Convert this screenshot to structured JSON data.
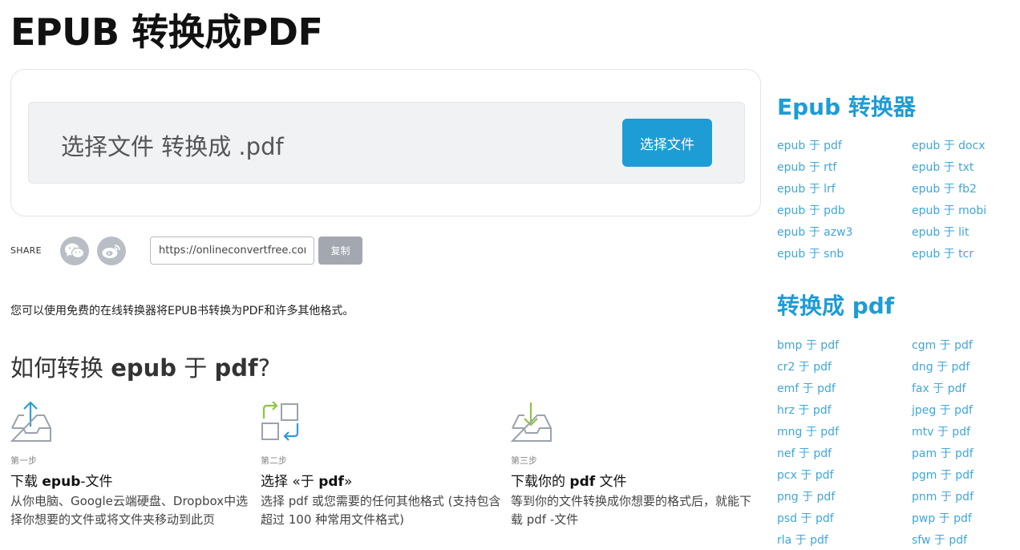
{
  "page_title": "EPUB 转换成PDF",
  "upload": {
    "prompt": "选择文件 转换成 .pdf",
    "choose_button": "选择文件"
  },
  "share": {
    "label": "SHARE",
    "url_value": "https://onlineconvertfree.com",
    "copy_button": "复制",
    "icons": [
      "wechat-icon",
      "weibo-icon"
    ]
  },
  "intro_text": "您可以使用免费的在线转换器将EPUB书转换为PDF和许多其他格式。",
  "howto": {
    "title_prefix": "如何转换 ",
    "title_src": "epub",
    "title_mid": " 于 ",
    "title_dst": "pdf",
    "title_suffix": "?",
    "steps": [
      {
        "num": "第一步",
        "title_pre": "下载 ",
        "title_bold": "epub",
        "title_post": "-文件",
        "desc": "从你电脑、Google云端硬盘、Dropbox中选择你想要的文件或将文件夹移动到此页",
        "icon": "upload-tray-icon"
      },
      {
        "num": "第二步",
        "title_pre": "选择 «于 ",
        "title_bold": "pdf",
        "title_post": "»",
        "desc": "选择 pdf 或您需要的任何其他格式 (支持包含超过 100 种常用文件格式)",
        "icon": "convert-arrows-icon"
      },
      {
        "num": "第三步",
        "title_pre": "下载你的 ",
        "title_bold": "pdf",
        "title_post": " 文件",
        "desc": "等到你的文件转换成你想要的格式后，就能下载 pdf -文件",
        "icon": "download-tray-icon"
      }
    ]
  },
  "sidebar": {
    "converters_heading": "Epub 转换器",
    "converter_links": [
      "epub 于 pdf",
      "epub 于 docx",
      "epub 于 rtf",
      "epub 于 txt",
      "epub 于 lrf",
      "epub 于 fb2",
      "epub 于 pdb",
      "epub 于 mobi",
      "epub 于 azw3",
      "epub 于 lit",
      "epub 于 snb",
      "epub 于 tcr"
    ],
    "to_pdf_heading": "转换成 pdf",
    "to_pdf_links": [
      "bmp 于 pdf",
      "cgm 于 pdf",
      "cr2 于 pdf",
      "dng 于 pdf",
      "emf 于 pdf",
      "fax 于 pdf",
      "hrz 于 pdf",
      "jpeg 于 pdf",
      "mng 于 pdf",
      "mtv 于 pdf",
      "nef 于 pdf",
      "pam 于 pdf",
      "pcx 于 pdf",
      "pgm 于 pdf",
      "png 于 pdf",
      "pnm 于 pdf",
      "psd 于 pdf",
      "pwp 于 pdf",
      "rla 于 pdf",
      "sfw 于 pdf"
    ]
  },
  "colors": {
    "accent": "#1e9cd6",
    "link": "#3fa6d9",
    "step_icon_blue": "#2e9cd9",
    "step_icon_green": "#8cc63f",
    "step_icon_gray": "#9aa3ad"
  }
}
